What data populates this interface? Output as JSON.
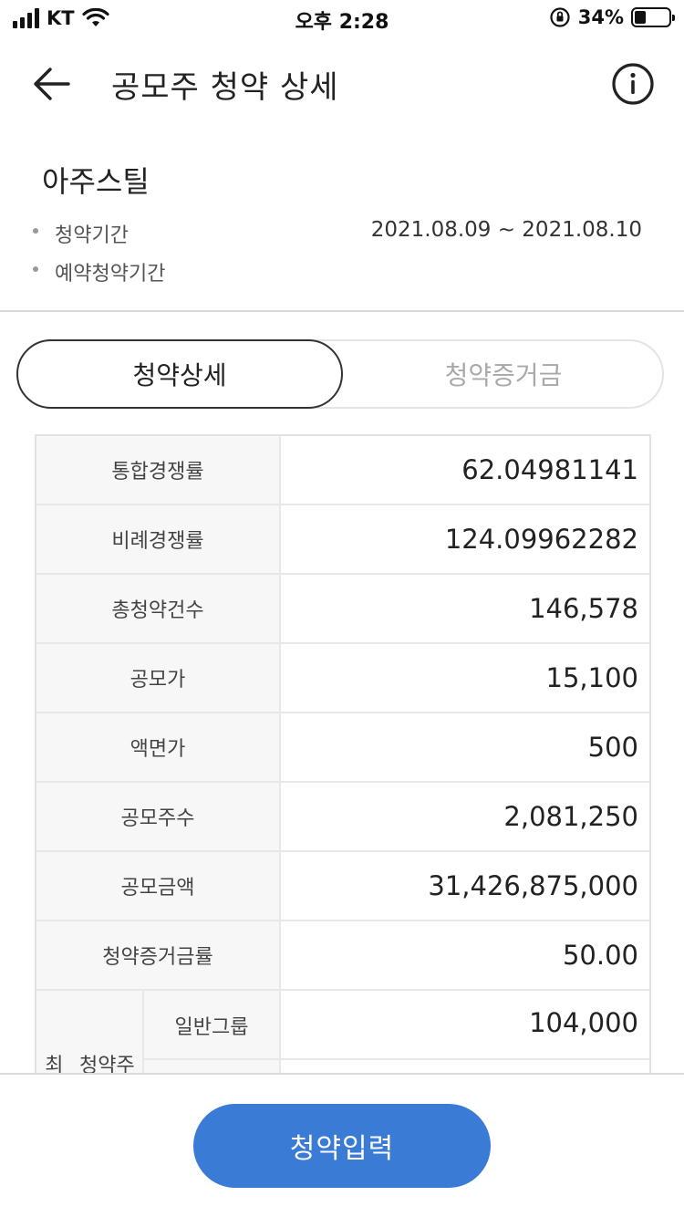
{
  "status_bar": {
    "carrier": "KT",
    "time": "오후 2:28",
    "battery_percent": "34%",
    "battery_level": 0.34
  },
  "header": {
    "title": "공모주 청약 상세"
  },
  "company": {
    "name": "아주스틸",
    "info": [
      {
        "label": "청약기간",
        "value": "2021.08.09 ~ 2021.08.10"
      },
      {
        "label": "예약청약기간",
        "value": ""
      }
    ]
  },
  "tabs": [
    {
      "label": "청약상세",
      "active": true
    },
    {
      "label": "청약증거금",
      "active": false
    }
  ],
  "details": {
    "rows": [
      {
        "label": "통합경쟁률",
        "value": "62.04981141"
      },
      {
        "label": "비례경쟁률",
        "value": "124.09962282"
      },
      {
        "label": "총청약건수",
        "value": "146,578"
      },
      {
        "label": "공모가",
        "value": "15,100"
      },
      {
        "label": "액면가",
        "value": "500"
      },
      {
        "label": "공모주수",
        "value": "2,081,250"
      },
      {
        "label": "공모금액",
        "value": "31,426,875,000"
      },
      {
        "label": "청약증거금률",
        "value": "50.00"
      }
    ],
    "max_shares": {
      "label_line1": "최대",
      "label_line2": "청약주수",
      "groups": [
        {
          "label": "일반그룹",
          "value": "104,000"
        },
        {
          "label": "",
          "value": ""
        }
      ]
    }
  },
  "bottom": {
    "submit_label": "청약입력"
  }
}
